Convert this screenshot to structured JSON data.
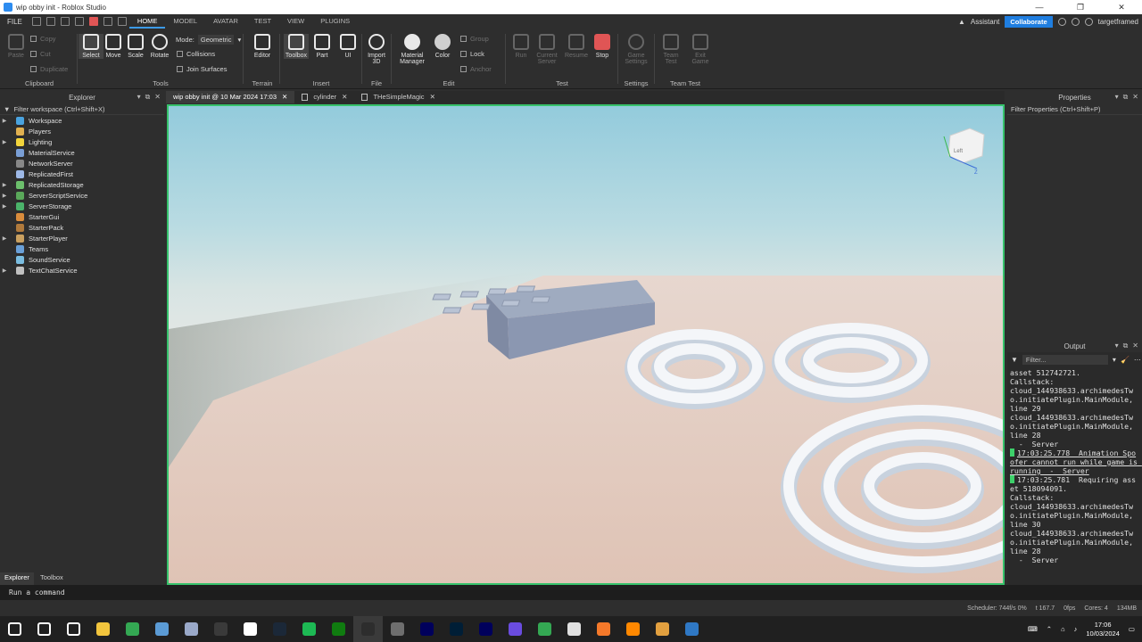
{
  "window": {
    "title": "wip obby init - Roblox Studio",
    "controls": [
      "—",
      "❐",
      "✕"
    ]
  },
  "menubar": {
    "file": "FILE",
    "tabs": [
      "HOME",
      "MODEL",
      "AVATAR",
      "TEST",
      "VIEW",
      "PLUGINS"
    ],
    "assistant": "Assistant",
    "collaborate": "Collaborate",
    "user": "targetframed"
  },
  "ribbon": {
    "clipboard": {
      "label": "Clipboard",
      "paste": "Paste",
      "copy": "Copy",
      "cut": "Cut",
      "duplicate": "Duplicate"
    },
    "tools": {
      "label": "Tools",
      "select": "Select",
      "move": "Move",
      "scale": "Scale",
      "rotate": "Rotate",
      "mode_label": "Mode:",
      "mode_value": "Geometric",
      "collisions": "Collisions",
      "join_surfaces": "Join Surfaces"
    },
    "terrain": {
      "label": "Terrain",
      "editor": "Editor"
    },
    "insert": {
      "label": "Insert",
      "toolbox": "Toolbox",
      "part": "Part",
      "ui": "UI"
    },
    "file": {
      "label": "File",
      "import3d_1": "Import",
      "import3d_2": "3D"
    },
    "edit": {
      "label": "Edit",
      "material_1": "Material",
      "material_2": "Manager",
      "color": "Color",
      "group": "Group",
      "lock": "Lock",
      "anchor": "Anchor"
    },
    "test": {
      "label": "Test",
      "run": "Run",
      "current_server_1": "Current",
      "current_server_2": "Server",
      "resume": "Resume",
      "stop": "Stop"
    },
    "settings": {
      "label": "Settings",
      "game_settings_1": "Game",
      "game_settings_2": "Settings"
    },
    "team_test": {
      "label": "Team Test",
      "team_test_1": "Team",
      "team_test_2": "Test",
      "exit_game_1": "Exit",
      "exit_game_2": "Game"
    }
  },
  "explorer": {
    "title": "Explorer",
    "filter": "Filter workspace (Ctrl+Shift+X)",
    "items": [
      {
        "label": "Workspace",
        "color": "#4aa3df",
        "expandable": true
      },
      {
        "label": "Players",
        "color": "#e0b050",
        "expandable": false
      },
      {
        "label": "Lighting",
        "color": "#f2d43c",
        "expandable": true
      },
      {
        "label": "MaterialService",
        "color": "#7a9fd6",
        "expandable": false
      },
      {
        "label": "NetworkServer",
        "color": "#888888",
        "expandable": false
      },
      {
        "label": "ReplicatedFirst",
        "color": "#9db8e6",
        "expandable": false
      },
      {
        "label": "ReplicatedStorage",
        "color": "#6cbf6c",
        "expandable": true
      },
      {
        "label": "ServerScriptService",
        "color": "#5aa85a",
        "expandable": true
      },
      {
        "label": "ServerStorage",
        "color": "#4bb36a",
        "expandable": true
      },
      {
        "label": "StarterGui",
        "color": "#d98c3c",
        "expandable": false
      },
      {
        "label": "StarterPack",
        "color": "#b07a3c",
        "expandable": false
      },
      {
        "label": "StarterPlayer",
        "color": "#c9a060",
        "expandable": true
      },
      {
        "label": "Teams",
        "color": "#6aa0d8",
        "expandable": false
      },
      {
        "label": "SoundService",
        "color": "#7bbde0",
        "expandable": false
      },
      {
        "label": "TextChatService",
        "color": "#c0c0c0",
        "expandable": true
      }
    ]
  },
  "bottom_tabs": [
    "Explorer",
    "Toolbox"
  ],
  "doc_tabs": [
    {
      "label": "wip obby init @ 10 Mar 2024 17:03",
      "active": true
    },
    {
      "label": "cylinder",
      "active": false
    },
    {
      "label": "THeSimpleMagic",
      "active": false
    }
  ],
  "properties": {
    "title": "Properties",
    "filter": "Filter Properties (Ctrl+Shift+P)"
  },
  "output": {
    "title": "Output",
    "filter_placeholder": "Filter...",
    "lines": [
      {
        "text": "asset 512742721.",
        "mark": false
      },
      {
        "text": "Callstack:",
        "mark": false
      },
      {
        "text": "cloud_144938633.archimedesTwo.initiatePlugin.MainModule, line 29",
        "mark": false
      },
      {
        "text": "cloud_144938633.archimedesTwo.initiatePlugin.MainModule, line 28",
        "mark": false
      },
      {
        "text": "  -  Server",
        "mark": false
      },
      {
        "text": "17:03:25.778  Animation Spoofer cannot run while game is running  -  Server",
        "mark": true
      },
      {
        "text": "17:03:25.781  Requiring asset 518094091.",
        "mark": true
      },
      {
        "text": "Callstack:",
        "mark": false
      },
      {
        "text": "cloud_144938633.archimedesTwo.initiatePlugin.MainModule, line 30",
        "mark": false
      },
      {
        "text": "cloud_144938633.archimedesTwo.initiatePlugin.MainModule, line 28",
        "mark": false
      },
      {
        "text": "  -  Server",
        "mark": false
      }
    ]
  },
  "command_bar": "Run a command",
  "statusbar": {
    "scheduler": "Scheduler: 744f/s 0%",
    "t": "t 167.7",
    "fps": "0fps",
    "cores": "Cores: 4",
    "mem": "134MB"
  },
  "viewcube": {
    "front": "Left",
    "axis": "Z"
  },
  "taskbar": {
    "icons": [
      "windows-start",
      "search",
      "task-view",
      "file-explorer",
      "chrome",
      "notepad-app",
      "camera-app",
      "obs",
      "mouse-app",
      "steam",
      "spotify",
      "xbox",
      "roblox-studio",
      "calculator",
      "after-effects",
      "photoshop",
      "premiere",
      "vpn",
      "chrome-2",
      "app-y",
      "blender",
      "vlc",
      "app-shield",
      "app-blue"
    ],
    "time": "17:06",
    "date": "10/03/2024"
  }
}
